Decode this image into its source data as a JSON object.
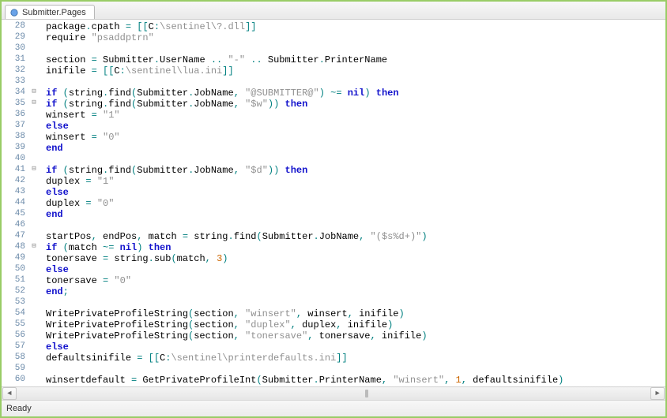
{
  "tab": {
    "title": "Submitter.Pages"
  },
  "statusbar": {
    "text": "Ready"
  },
  "code": {
    "lines": [
      {
        "n": 28,
        "fold": "",
        "tokens": [
          [
            "id",
            "package"
          ],
          [
            "op",
            "."
          ],
          [
            "id",
            "cpath"
          ],
          [
            "id",
            " "
          ],
          [
            "op",
            "="
          ],
          [
            "id",
            " "
          ],
          [
            "op",
            "[["
          ],
          [
            "id",
            "C"
          ],
          [
            "op",
            ":"
          ],
          [
            "str",
            "\\sentinel\\?.dll"
          ],
          [
            "op",
            "]]"
          ]
        ]
      },
      {
        "n": 29,
        "fold": "",
        "tokens": [
          [
            "id",
            "require "
          ],
          [
            "str",
            "\"psaddptrn\""
          ]
        ]
      },
      {
        "n": 30,
        "fold": "",
        "tokens": []
      },
      {
        "n": 31,
        "fold": "",
        "tokens": [
          [
            "id",
            "section "
          ],
          [
            "op",
            "="
          ],
          [
            "id",
            " Submitter"
          ],
          [
            "op",
            "."
          ],
          [
            "id",
            "UserName "
          ],
          [
            "op",
            ".."
          ],
          [
            "id",
            " "
          ],
          [
            "str",
            "\"-\""
          ],
          [
            "id",
            " "
          ],
          [
            "op",
            ".."
          ],
          [
            "id",
            " Submitter"
          ],
          [
            "op",
            "."
          ],
          [
            "id",
            "PrinterName"
          ]
        ]
      },
      {
        "n": 32,
        "fold": "",
        "tokens": [
          [
            "id",
            "inifile "
          ],
          [
            "op",
            "="
          ],
          [
            "id",
            " "
          ],
          [
            "op",
            "[["
          ],
          [
            "id",
            "C"
          ],
          [
            "op",
            ":"
          ],
          [
            "str",
            "\\sentinel\\lua.ini"
          ],
          [
            "op",
            "]]"
          ]
        ]
      },
      {
        "n": 33,
        "fold": "",
        "tokens": []
      },
      {
        "n": 34,
        "fold": "⊟",
        "tokens": [
          [
            "kw",
            "if"
          ],
          [
            "id",
            " "
          ],
          [
            "op",
            "("
          ],
          [
            "id",
            "string"
          ],
          [
            "op",
            "."
          ],
          [
            "id",
            "find"
          ],
          [
            "op",
            "("
          ],
          [
            "id",
            "Submitter"
          ],
          [
            "op",
            "."
          ],
          [
            "id",
            "JobName"
          ],
          [
            "op",
            ","
          ],
          [
            "id",
            " "
          ],
          [
            "str",
            "\"@SUBMITTER@\""
          ],
          [
            "op",
            ")"
          ],
          [
            "id",
            " "
          ],
          [
            "op",
            "~="
          ],
          [
            "id",
            " "
          ],
          [
            "kw",
            "nil"
          ],
          [
            "op",
            ")"
          ],
          [
            "id",
            " "
          ],
          [
            "kw",
            "then"
          ]
        ]
      },
      {
        "n": 35,
        "fold": "⊟",
        "tokens": [
          [
            "id",
            "    "
          ],
          [
            "kw",
            "if"
          ],
          [
            "id",
            " "
          ],
          [
            "op",
            "("
          ],
          [
            "id",
            "string"
          ],
          [
            "op",
            "."
          ],
          [
            "id",
            "find"
          ],
          [
            "op",
            "("
          ],
          [
            "id",
            "Submitter"
          ],
          [
            "op",
            "."
          ],
          [
            "id",
            "JobName"
          ],
          [
            "op",
            ","
          ],
          [
            "id",
            " "
          ],
          [
            "str",
            "\"$w\""
          ],
          [
            "op",
            "))"
          ],
          [
            "id",
            " "
          ],
          [
            "kw",
            "then"
          ]
        ]
      },
      {
        "n": 36,
        "fold": "",
        "tokens": [
          [
            "id",
            "        winsert "
          ],
          [
            "op",
            "="
          ],
          [
            "id",
            " "
          ],
          [
            "str",
            "\"1\""
          ]
        ]
      },
      {
        "n": 37,
        "fold": "",
        "tokens": [
          [
            "id",
            "    "
          ],
          [
            "kw",
            "else"
          ]
        ]
      },
      {
        "n": 38,
        "fold": "",
        "tokens": [
          [
            "id",
            "        winsert "
          ],
          [
            "op",
            "="
          ],
          [
            "id",
            " "
          ],
          [
            "str",
            "\"0\""
          ]
        ]
      },
      {
        "n": 39,
        "fold": "",
        "tokens": [
          [
            "id",
            "    "
          ],
          [
            "kw",
            "end"
          ]
        ]
      },
      {
        "n": 40,
        "fold": "",
        "tokens": []
      },
      {
        "n": 41,
        "fold": "⊟",
        "tokens": [
          [
            "id",
            "    "
          ],
          [
            "kw",
            "if"
          ],
          [
            "id",
            " "
          ],
          [
            "op",
            "("
          ],
          [
            "id",
            "string"
          ],
          [
            "op",
            "."
          ],
          [
            "id",
            "find"
          ],
          [
            "op",
            "("
          ],
          [
            "id",
            "Submitter"
          ],
          [
            "op",
            "."
          ],
          [
            "id",
            "JobName"
          ],
          [
            "op",
            ","
          ],
          [
            "id",
            " "
          ],
          [
            "str",
            "\"$d\""
          ],
          [
            "op",
            "))"
          ],
          [
            "id",
            " "
          ],
          [
            "kw",
            "then"
          ]
        ]
      },
      {
        "n": 42,
        "fold": "",
        "tokens": [
          [
            "id",
            "        duplex "
          ],
          [
            "op",
            "="
          ],
          [
            "id",
            " "
          ],
          [
            "str",
            "\"1\""
          ]
        ]
      },
      {
        "n": 43,
        "fold": "",
        "tokens": [
          [
            "id",
            "    "
          ],
          [
            "kw",
            "else"
          ]
        ]
      },
      {
        "n": 44,
        "fold": "",
        "tokens": [
          [
            "id",
            "        duplex "
          ],
          [
            "op",
            "="
          ],
          [
            "id",
            " "
          ],
          [
            "str",
            "\"0\""
          ]
        ]
      },
      {
        "n": 45,
        "fold": "",
        "tokens": [
          [
            "id",
            "    "
          ],
          [
            "kw",
            "end"
          ]
        ]
      },
      {
        "n": 46,
        "fold": "",
        "tokens": []
      },
      {
        "n": 47,
        "fold": "",
        "tokens": [
          [
            "id",
            "    startPos"
          ],
          [
            "op",
            ","
          ],
          [
            "id",
            " endPos"
          ],
          [
            "op",
            ","
          ],
          [
            "id",
            " match "
          ],
          [
            "op",
            "="
          ],
          [
            "id",
            " string"
          ],
          [
            "op",
            "."
          ],
          [
            "id",
            "find"
          ],
          [
            "op",
            "("
          ],
          [
            "id",
            "Submitter"
          ],
          [
            "op",
            "."
          ],
          [
            "id",
            "JobName"
          ],
          [
            "op",
            ","
          ],
          [
            "id",
            " "
          ],
          [
            "str",
            "\"($s%d+)\""
          ],
          [
            "op",
            ")"
          ]
        ]
      },
      {
        "n": 48,
        "fold": "⊟",
        "tokens": [
          [
            "id",
            "    "
          ],
          [
            "kw",
            "if"
          ],
          [
            "id",
            " "
          ],
          [
            "op",
            "("
          ],
          [
            "id",
            "match "
          ],
          [
            "op",
            "~="
          ],
          [
            "id",
            " "
          ],
          [
            "kw",
            "nil"
          ],
          [
            "op",
            ")"
          ],
          [
            "id",
            " "
          ],
          [
            "kw",
            "then"
          ]
        ]
      },
      {
        "n": 49,
        "fold": "",
        "tokens": [
          [
            "id",
            "        tonersave "
          ],
          [
            "op",
            "="
          ],
          [
            "id",
            " string"
          ],
          [
            "op",
            "."
          ],
          [
            "id",
            "sub"
          ],
          [
            "op",
            "("
          ],
          [
            "id",
            "match"
          ],
          [
            "op",
            ","
          ],
          [
            "id",
            " "
          ],
          [
            "num",
            "3"
          ],
          [
            "op",
            ")"
          ]
        ]
      },
      {
        "n": 50,
        "fold": "",
        "tokens": [
          [
            "id",
            "    "
          ],
          [
            "kw",
            "else"
          ]
        ]
      },
      {
        "n": 51,
        "fold": "",
        "tokens": [
          [
            "id",
            "        tonersave "
          ],
          [
            "op",
            "="
          ],
          [
            "id",
            " "
          ],
          [
            "str",
            "\"0\""
          ]
        ]
      },
      {
        "n": 52,
        "fold": "",
        "tokens": [
          [
            "id",
            "    "
          ],
          [
            "kw",
            "end"
          ],
          [
            "op",
            ";"
          ]
        ]
      },
      {
        "n": 53,
        "fold": "",
        "tokens": []
      },
      {
        "n": 54,
        "fold": "",
        "tokens": [
          [
            "id",
            "    WritePrivateProfileString"
          ],
          [
            "op",
            "("
          ],
          [
            "id",
            "section"
          ],
          [
            "op",
            ","
          ],
          [
            "id",
            " "
          ],
          [
            "str",
            "\"winsert\""
          ],
          [
            "op",
            ","
          ],
          [
            "id",
            " winsert"
          ],
          [
            "op",
            ","
          ],
          [
            "id",
            " inifile"
          ],
          [
            "op",
            ")"
          ]
        ]
      },
      {
        "n": 55,
        "fold": "",
        "tokens": [
          [
            "id",
            "    WritePrivateProfileString"
          ],
          [
            "op",
            "("
          ],
          [
            "id",
            "section"
          ],
          [
            "op",
            ","
          ],
          [
            "id",
            " "
          ],
          [
            "str",
            "\"duplex\""
          ],
          [
            "op",
            ","
          ],
          [
            "id",
            " duplex"
          ],
          [
            "op",
            ","
          ],
          [
            "id",
            " inifile"
          ],
          [
            "op",
            ")"
          ]
        ]
      },
      {
        "n": 56,
        "fold": "",
        "tokens": [
          [
            "id",
            "    WritePrivateProfileString"
          ],
          [
            "op",
            "("
          ],
          [
            "id",
            "section"
          ],
          [
            "op",
            ","
          ],
          [
            "id",
            " "
          ],
          [
            "str",
            "\"tonersave\""
          ],
          [
            "op",
            ","
          ],
          [
            "id",
            " tonersave"
          ],
          [
            "op",
            ","
          ],
          [
            "id",
            " inifile"
          ],
          [
            "op",
            ")"
          ]
        ]
      },
      {
        "n": 57,
        "fold": "",
        "tokens": [
          [
            "kw",
            "else"
          ]
        ]
      },
      {
        "n": 58,
        "fold": "",
        "tokens": [
          [
            "id",
            "    defaultsinifile "
          ],
          [
            "op",
            "="
          ],
          [
            "id",
            " "
          ],
          [
            "op",
            "[["
          ],
          [
            "id",
            "C"
          ],
          [
            "op",
            ":"
          ],
          [
            "str",
            "\\sentinel\\printerdefaults.ini"
          ],
          [
            "op",
            "]]"
          ]
        ]
      },
      {
        "n": 59,
        "fold": "",
        "tokens": []
      },
      {
        "n": 60,
        "fold": "",
        "tokens": [
          [
            "id",
            "    winsertdefault "
          ],
          [
            "op",
            "="
          ],
          [
            "id",
            " GetPrivateProfileInt"
          ],
          [
            "op",
            "("
          ],
          [
            "id",
            "Submitter"
          ],
          [
            "op",
            "."
          ],
          [
            "id",
            "PrinterName"
          ],
          [
            "op",
            ","
          ],
          [
            "id",
            " "
          ],
          [
            "str",
            "\"winsert\""
          ],
          [
            "op",
            ","
          ],
          [
            "id",
            " "
          ],
          [
            "num",
            "1"
          ],
          [
            "op",
            ","
          ],
          [
            "id",
            " defaultsinifile"
          ],
          [
            "op",
            ")"
          ]
        ]
      }
    ]
  }
}
